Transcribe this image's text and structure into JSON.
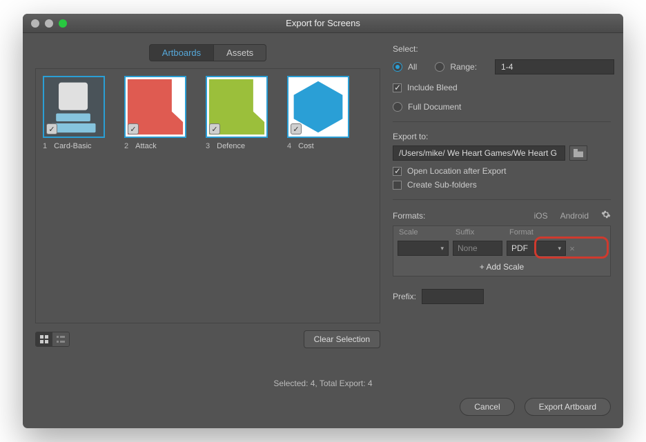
{
  "titlebar": {
    "title": "Export for Screens"
  },
  "tabs": {
    "artboards": "Artboards",
    "assets": "Assets",
    "active": "artboards"
  },
  "artboards": [
    {
      "num": "1",
      "name": "Card-Basic"
    },
    {
      "num": "2",
      "name": "Attack"
    },
    {
      "num": "3",
      "name": "Defence"
    },
    {
      "num": "4",
      "name": "Cost"
    }
  ],
  "clear_selection": "Clear Selection",
  "status": "Selected: 4, Total Export: 4",
  "select": {
    "label": "Select:",
    "all": "All",
    "range": "Range:",
    "range_value": "1-4",
    "include_bleed": "Include Bleed",
    "full_document": "Full Document"
  },
  "export_to": {
    "label": "Export to:",
    "path": "/Users/mike/ We Heart Games/We Heart G",
    "open_after": "Open Location after Export",
    "create_sub": "Create Sub-folders"
  },
  "formats": {
    "label": "Formats:",
    "ios": "iOS",
    "android": "Android",
    "col_scale": "Scale",
    "col_suffix": "Suffix",
    "col_format": "Format",
    "scale_value": "",
    "suffix_value": "None",
    "format_value": "PDF",
    "add_scale": "+  Add Scale"
  },
  "prefix": {
    "label": "Prefix:",
    "value": ""
  },
  "actions": {
    "cancel": "Cancel",
    "export": "Export Artboard"
  }
}
